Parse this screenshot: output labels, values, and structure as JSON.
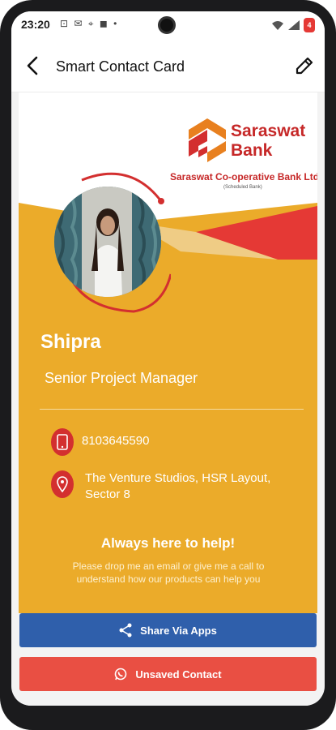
{
  "status_bar": {
    "time": "23:20",
    "left_icons": "⊡ ✉ ⌖ ◼ •",
    "battery": "4"
  },
  "app_bar": {
    "title": "Smart Contact Card",
    "back_icon": "arrow-left-icon",
    "edit_icon": "pencil-icon"
  },
  "bank": {
    "name": "Saraswat Bank",
    "full_name": "Saraswat Co-operative Bank Ltd.",
    "tagline": "(Scheduled Bank)"
  },
  "profile": {
    "name": "Shipra",
    "role": "Senior Project Manager"
  },
  "contacts": {
    "phone": "8103645590",
    "address": "The Venture Studios, HSR Layout, Sector 8"
  },
  "help": {
    "title": "Always here to help!",
    "text": "Please drop me an email or give me a call to understand how our products can help you"
  },
  "actions": {
    "share_label": "Share Via Apps",
    "save_label": "Unsaved Contact"
  },
  "colors": {
    "card_yellow": "#ebab2a",
    "brand_red": "#e53935",
    "share_blue": "#2f5fab",
    "save_red": "#e94f43"
  }
}
